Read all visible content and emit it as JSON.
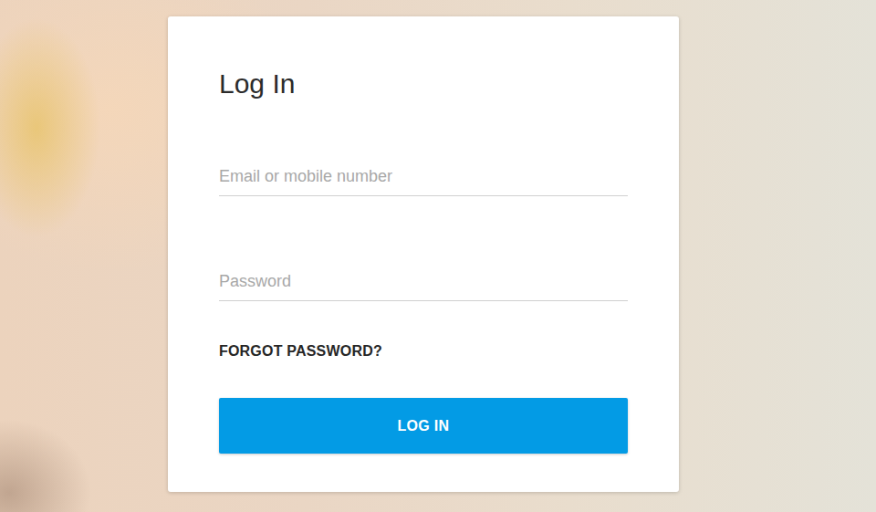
{
  "title": "Log In",
  "fields": [
    {
      "placeholder": "Email or mobile number",
      "kind": "text"
    },
    {
      "placeholder": "Password",
      "kind": "password"
    }
  ],
  "forgot": "FORGOT PASSWORD?",
  "submit": "LOG IN"
}
